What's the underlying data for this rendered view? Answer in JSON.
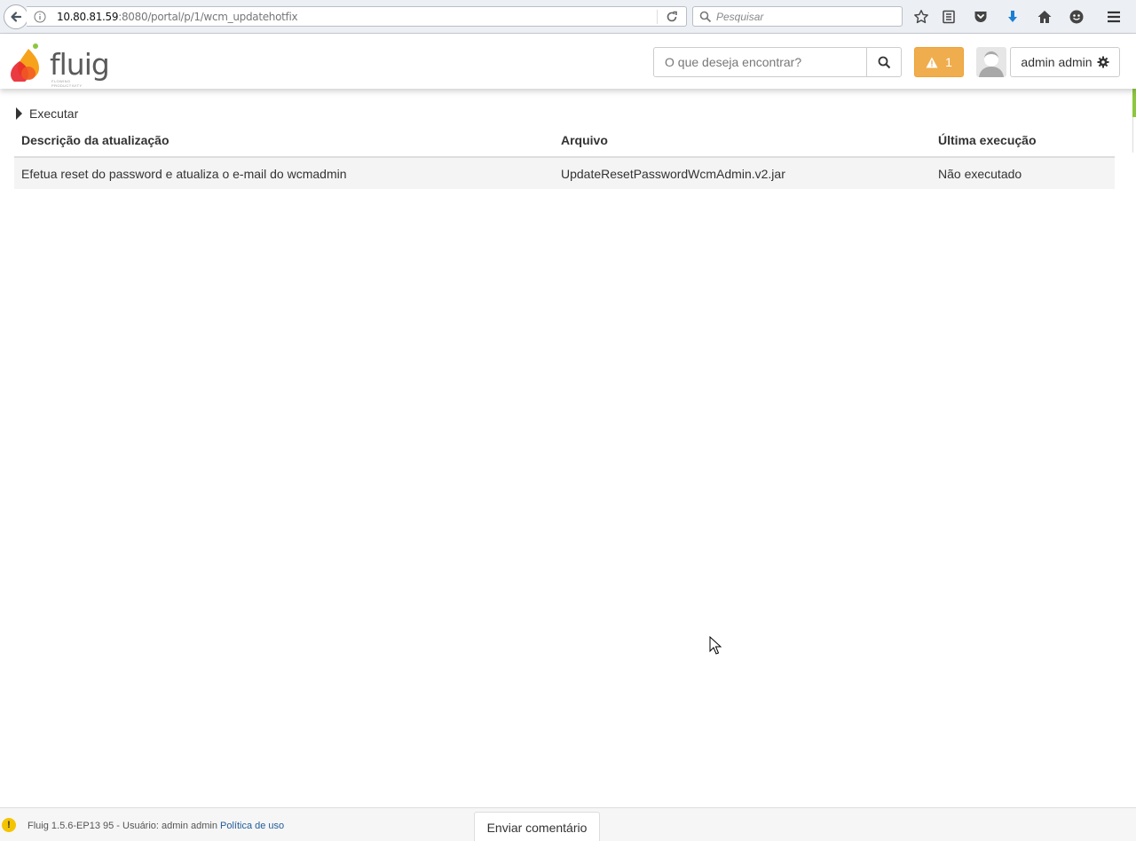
{
  "browser": {
    "url_host": "10.80.81.59",
    "url_rest": ":8080/portal/p/1/wcm_updatehotfix",
    "search_placeholder": "Pesquisar"
  },
  "header": {
    "logo_text": "fluig",
    "logo_tagline": "FLOWING PRODUCTIVITY",
    "search_placeholder": "O que deseja encontrar?",
    "alert_count": "1",
    "user_name": "admin admin"
  },
  "main": {
    "section_label": "Executar",
    "table": {
      "headers": [
        "Descrição da atualização",
        "Arquivo",
        "Última execução"
      ],
      "rows": [
        [
          "Efetua reset do password e atualiza o e-mail do wcmadmin",
          "UpdateResetPasswordWcmAdmin.v2.jar",
          "Não executado"
        ]
      ]
    }
  },
  "footer": {
    "warning_glyph": "!",
    "version_text": "Fluig 1.5.6-EP13 95 - Usuário: admin admin",
    "policy_link": "Política de uso",
    "feedback_button": "Enviar comentário"
  },
  "colors": {
    "alert_orange": "#f0ad4e",
    "accent_green": "#8dc63f",
    "link_blue": "#1f5c99"
  }
}
